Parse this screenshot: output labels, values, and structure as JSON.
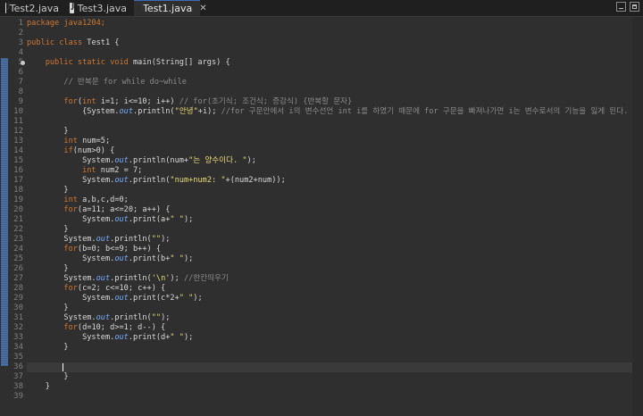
{
  "tabs": [
    {
      "label": "Test2.java",
      "active": false
    },
    {
      "label": "Test3.java",
      "active": false
    },
    {
      "label": "Test1.java",
      "active": true
    }
  ],
  "close_symbol": "✕",
  "line_numbers": [
    "1",
    "2",
    "3",
    "4",
    "5",
    "6",
    "7",
    "8",
    "9",
    "10",
    "11",
    "12",
    "13",
    "14",
    "15",
    "16",
    "17",
    "18",
    "19",
    "20",
    "21",
    "22",
    "23",
    "24",
    "25",
    "26",
    "27",
    "28",
    "29",
    "30",
    "31",
    "32",
    "33",
    "34",
    "35",
    "36",
    "37",
    "38",
    "39"
  ],
  "code": {
    "l1": "package java1204;",
    "l3_kw": "public class",
    "l3_rest": " Test1 {",
    "l5_kw": "    public static void",
    "l5_rest": " main(String[] args) {",
    "l7": "        // 반복문 for while do~while",
    "l9_kw": "        for",
    "l9_a": "(",
    "l9_int": "int",
    "l9_b": " i=1; i<=10; i++) ",
    "l9_c": "// for(초기식; 조건식; 증감식) {반복할 문자}",
    "l10_a": "            {System.",
    "l10_out": "out",
    "l10_b": ".println(",
    "l10_s": "\"안녕\"",
    "l10_c": "+i); ",
    "l10_cmt": "//for 구문안에서 i의 변수선언 int i를 하였기 때문에 for 구문을 빠져나가면 i는 변수로서의 기능을 잃게 된다.",
    "l12": "        }",
    "l13_int": "        int",
    "l13_rest": " num=5;",
    "l14_if": "        if",
    "l14_rest": "(num>0) {",
    "l15_a": "            System.",
    "l15_out": "out",
    "l15_b": ".println(num+",
    "l15_s": "\"는 양수이다. \"",
    "l15_c": ");",
    "l16_int": "            int",
    "l16_rest": " num2 = 7;",
    "l17_a": "            System.",
    "l17_out": "out",
    "l17_b": ".println(",
    "l17_s": "\"num+num2: \"",
    "l17_c": "+(num2+num));",
    "l18": "        }",
    "l19_int": "        int",
    "l19_rest": " a,b,c,d=0;",
    "l20_for": "        for",
    "l20_rest": "(a=11; a<=20; a++) {",
    "l21_a": "            System.",
    "l21_out": "out",
    "l21_b": ".print(a+",
    "l21_s": "\" \"",
    "l21_c": ");",
    "l22": "        }",
    "l23_a": "        System.",
    "l23_out": "out",
    "l23_b": ".println(",
    "l23_s": "\"\"",
    "l23_c": ");",
    "l24_for": "        for",
    "l24_rest": "(b=0; b<=9; b++) {",
    "l25_a": "            System.",
    "l25_out": "out",
    "l25_b": ".print(b+",
    "l25_s": "\" \"",
    "l25_c": ");",
    "l26": "        }",
    "l27_a": "        System.",
    "l27_out": "out",
    "l27_b": ".println(",
    "l27_s": "'\\n'",
    "l27_c": "); ",
    "l27_cmt": "//한칸띄우기",
    "l28_for": "        for",
    "l28_rest": "(c=2; c<=10; c++) {",
    "l29_a": "            System.",
    "l29_out": "out",
    "l29_b": ".print(c*2+",
    "l29_s": "\" \"",
    "l29_c": ");",
    "l30": "        }",
    "l31_a": "        System.",
    "l31_out": "out",
    "l31_b": ".println(",
    "l31_s": "\"\"",
    "l31_c": ");",
    "l32_for": "        for",
    "l32_rest": "(d=10; d>=1; d--) {",
    "l33_a": "            System.",
    "l33_out": "out",
    "l33_b": ".print(d+",
    "l33_s": "\" \"",
    "l33_c": ");",
    "l34": "        }",
    "l36": "        }",
    "l37": "    }"
  }
}
